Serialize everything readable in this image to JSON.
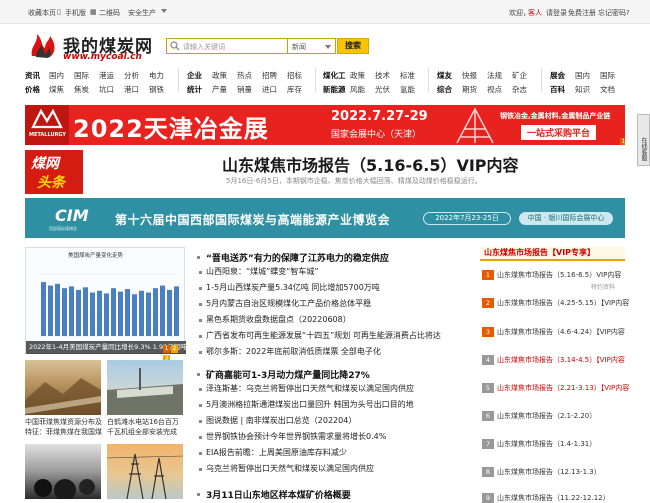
{
  "topbar": {
    "left": [
      "收藏本页",
      "手机版",
      "二维码",
      "安全生产"
    ],
    "right": {
      "welcome": "欢迎，",
      "guest": "客人",
      "login": "请登录",
      "register": "免费注册",
      "forgot": "忘记密码?"
    }
  },
  "logo": {
    "title": "我的煤炭网",
    "url": "www.mycoal.cn"
  },
  "search": {
    "placeholder": "请输入关键词",
    "category": "新闻",
    "button": "搜索"
  },
  "nav": {
    "g1r1": [
      "资讯",
      "国内",
      "国际",
      "港运",
      "分析",
      "电力"
    ],
    "g1r2": [
      "价格",
      "煤焦",
      "焦炭",
      "坑口",
      "港口",
      "钢铁"
    ],
    "g2r1": [
      "企业",
      "政策",
      "热点",
      "招聘",
      "招标"
    ],
    "g2r2": [
      "统计",
      "产量",
      "销量",
      "进口",
      "库存"
    ],
    "g3r1": [
      "煤化工",
      "政策",
      "技术",
      "标准"
    ],
    "g3r2": [
      "新能源",
      "风能",
      "光伏",
      "氢能"
    ],
    "g4r1": [
      "煤友",
      "快报",
      "法规",
      "矿企"
    ],
    "g4r2": [
      "综合",
      "期货",
      "视点",
      "杂志"
    ],
    "g5r1": [
      "展会",
      "国内",
      "国际"
    ],
    "g5r2": [
      "百科",
      "知识",
      "文档"
    ]
  },
  "banner1": {
    "metal": "METALLURGY",
    "title": "2022天津冶金展",
    "date": "2022.7.27-29",
    "venue": "国家会展中心（天津）",
    "right1": "钢铁冶金,金属材料,金属制品产业链",
    "right2": "一站式采购平台",
    "pages": [
      "1",
      "2",
      "3"
    ]
  },
  "float_ad": "在线客服",
  "badge": {
    "l1": "煤网",
    "l2": "头条"
  },
  "headline": {
    "title": "山东煤焦市场报告（5.16-6.5）VIP内容",
    "sub": "5月16日-6月5日，本期钢市企稳、焦炭价格大幅回落、精煤及动煤价格稳稳运行。"
  },
  "banner2": {
    "logo": "CIM",
    "logo_sub": "西部国际煤博会",
    "title": "第十六届中国西部国际煤炭与高端能源产业博览会",
    "date": "2022年7月23-25日",
    "location": "中国 · 银川国际会展中心"
  },
  "chart_box": {
    "title": "美国煤炭产量变化走势",
    "caption": "2022年1-4月美国煤炭产量同比增长9.3% 1.93亿短吨",
    "pages": [
      "1",
      "2",
      "3"
    ]
  },
  "chart_data": {
    "type": "bar",
    "title": "美国煤炭产量变化走势",
    "values": [
      62,
      58,
      60,
      55,
      57,
      53,
      56,
      50,
      52,
      49,
      55,
      51,
      54,
      48,
      52,
      50,
      55,
      58,
      53,
      57
    ]
  },
  "photos": [
    {
      "caption": "中国菲煤焦煤资源分布及特征：菲煤焦煤在我国煤"
    },
    {
      "caption": "白鹤滩水电站16台百万千瓦机组全部安装完成"
    }
  ],
  "news": {
    "g1_title": "“晋电送苏”有力的保障了江苏电力的稳定供应",
    "g1": [
      "山西阳泉：“煤城”蝶变“智车城”",
      "1-5月山西煤炭产量5.34亿吨 同比增加5700万吨",
      "5月内蒙古自治区规模煤化工产品价格总体平稳",
      "黑色系期货收盘数据盘点（20220608）",
      "广西省发布可再生能源发展“十四五”规划 可再生能源消费占比将达",
      "鄂尔多斯：2022年底前取消低质煤票 全部电子化"
    ],
    "g2_title": "矿商嘉能可1-3月动力煤产量同比降27%",
    "g2": [
      "泽连斯基：乌克兰将暂停出口天然气和煤炭以满足国内供应",
      "5月澳洲格拉斯通港煤炭出口量回升 韩国为头号出口目的地",
      "图说数据 | 南非煤炭出口总览（202204）",
      "世界钢铁协会预计今年世界钢铁需求量将增长0.4%",
      "EIA报告前瞻：上周美国原油库存料减少",
      "乌克兰将暂停出口天然气和煤炭以满足国内供应"
    ],
    "g3_title": "3月11日山东地区样本煤矿价格概要"
  },
  "side": {
    "head": "山东煤焦市场报告【VIP专享】",
    "items": [
      {
        "text": "山东煤焦市场报告（5.16-6.5）VIP内容",
        "sub": "特约资料",
        "red": false
      },
      {
        "text": "山东煤焦市场报告（4.25-5.15）【VIP内容",
        "sub": "",
        "red": false
      },
      {
        "text": "山东煤焦市场报告（4.6-4.24）【VIP内容",
        "sub": "",
        "red": false
      },
      {
        "text": "山东煤焦市场报告（3.14-4.5）【VIP内容",
        "sub": "",
        "red": true
      },
      {
        "text": "山东煤焦市场报告（2.21-3.13）【VIP内容",
        "sub": "",
        "red": true
      },
      {
        "text": "山东煤焦市场报告（2.1-2.20）",
        "sub": "",
        "red": false
      },
      {
        "text": "山东煤焦市场报告（1.4-1.31）",
        "sub": "",
        "red": false
      },
      {
        "text": "山东煤焦市场报告（12.13-1.3）",
        "sub": "",
        "red": false
      },
      {
        "text": "山东煤焦市场报告（11.22-12.12）",
        "sub": "",
        "red": false
      }
    ]
  }
}
